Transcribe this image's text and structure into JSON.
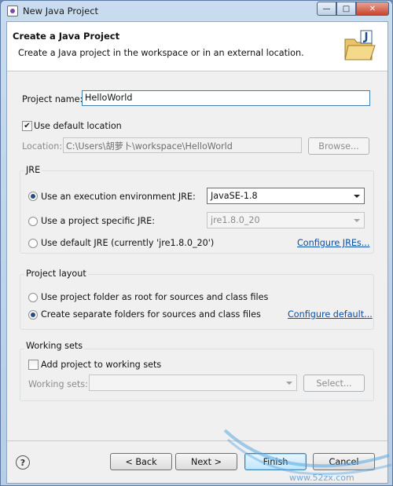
{
  "window": {
    "title": "New Java Project"
  },
  "header": {
    "title": "Create a Java Project",
    "description": "Create a Java project in the workspace or in an external location."
  },
  "project_name": {
    "label": "Project name:",
    "value": "HelloWorld"
  },
  "use_default_location": {
    "label": "Use default location",
    "checked": true
  },
  "location": {
    "label": "Location:",
    "value": "C:\\Users\\胡萝卜\\workspace\\HelloWorld",
    "browse_label": "Browse..."
  },
  "jre": {
    "title": "JRE",
    "execution_env": {
      "label": "Use an execution environment JRE:",
      "value": "JavaSE-1.8",
      "selected": true
    },
    "project_specific": {
      "label": "Use a project specific JRE:",
      "value": "jre1.8.0_20",
      "selected": false
    },
    "default_jre": {
      "label": "Use default JRE (currently 'jre1.8.0_20')",
      "selected": false
    },
    "configure_link": "Configure JREs..."
  },
  "project_layout": {
    "title": "Project layout",
    "option_root": "Use project folder as root for sources and class files",
    "option_separate": "Create separate folders for sources and class files",
    "configure_link": "Configure default..."
  },
  "working_sets": {
    "title": "Working sets",
    "add_label": "Add project to working sets",
    "sets_label": "Working sets:",
    "select_label": "Select..."
  },
  "footer": {
    "help": "?",
    "back": "< Back",
    "next": "Next >",
    "finish": "Finish",
    "cancel": "Cancel"
  },
  "watermark": {
    "text": "www.52zx.com"
  }
}
